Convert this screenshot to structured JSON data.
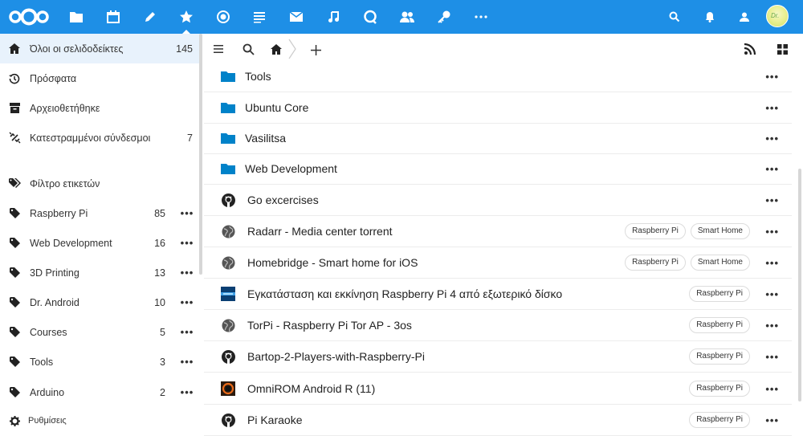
{
  "header": {
    "apps": [
      "logo-icon",
      "files-icon",
      "calendar-icon",
      "notes-icon",
      "bookmarks-icon",
      "photos-icon",
      "news-icon",
      "mail-icon",
      "music-icon",
      "talk-icon",
      "contacts-icon",
      "passwords-icon",
      "more-apps-icon"
    ],
    "active_app": "bookmarks-icon",
    "right_icons": [
      "search-icon",
      "notifications-icon",
      "contacts-menu-icon"
    ],
    "avatar_text": "Dr."
  },
  "sidebar": {
    "items": [
      {
        "label": "Όλοι οι σελιδοδείκτες",
        "count": "145",
        "icon": "home-icon",
        "active": true
      },
      {
        "label": "Πρόσφατα",
        "count": "",
        "icon": "history-icon"
      },
      {
        "label": "Αρχειοθετήθηκε",
        "count": "",
        "icon": "archive-icon"
      },
      {
        "label": "Κατεστραμμένοι σύνδεσμοι",
        "count": "7",
        "icon": "broken-link-icon"
      }
    ],
    "tag_filter_label": "Φίλτρο ετικετών",
    "tags": [
      {
        "label": "Raspberry Pi",
        "count": "85"
      },
      {
        "label": "Web Development",
        "count": "16"
      },
      {
        "label": "3D Printing",
        "count": "13"
      },
      {
        "label": "Dr. Android",
        "count": "10"
      },
      {
        "label": "Courses",
        "count": "5"
      },
      {
        "label": "Tools",
        "count": "3"
      },
      {
        "label": "Arduino",
        "count": "2"
      }
    ],
    "settings_label": "Ρυθμίσεις"
  },
  "toolbar": {
    "icons": [
      "menu-icon",
      "search-icon",
      "home-icon",
      "chevron-right-icon",
      "add-icon"
    ],
    "right_icons": [
      "rss-icon",
      "grid-view-icon"
    ]
  },
  "rows": [
    {
      "type": "folder",
      "label": "Tools",
      "tags": []
    },
    {
      "type": "folder",
      "label": "Ubuntu Core",
      "tags": []
    },
    {
      "type": "folder",
      "label": "Vasilitsa",
      "tags": []
    },
    {
      "type": "folder",
      "label": "Web Development",
      "tags": []
    },
    {
      "type": "github",
      "label": "Go excercises",
      "tags": []
    },
    {
      "type": "globe",
      "label": "Radarr - Media center torrent",
      "tags": [
        "Raspberry Pi",
        "Smart Home"
      ]
    },
    {
      "type": "globe",
      "label": "Homebridge - Smart home for iOS",
      "tags": [
        "Raspberry Pi",
        "Smart Home"
      ]
    },
    {
      "type": "image-blue",
      "label": "Εγκατάσταση και εκκίνηση Raspberry Pi 4 από εξωτερικό δίσκο",
      "tags": [
        "Raspberry Pi"
      ]
    },
    {
      "type": "globe",
      "label": "TorPi - Raspberry Pi Tor AP - 3os",
      "tags": [
        "Raspberry Pi"
      ]
    },
    {
      "type": "github",
      "label": "Bartop-2-Players-with-Raspberry-Pi",
      "tags": [
        "Raspberry Pi"
      ]
    },
    {
      "type": "image-orange",
      "label": "OmniROM Android R (11)",
      "tags": [
        "Raspberry Pi"
      ]
    },
    {
      "type": "github",
      "label": "Pi Karaoke",
      "tags": [
        "Raspberry Pi"
      ]
    }
  ],
  "colors": {
    "header": "#1e8fe6",
    "folder": "#0082c9",
    "active_bg": "#e8f2fc"
  }
}
